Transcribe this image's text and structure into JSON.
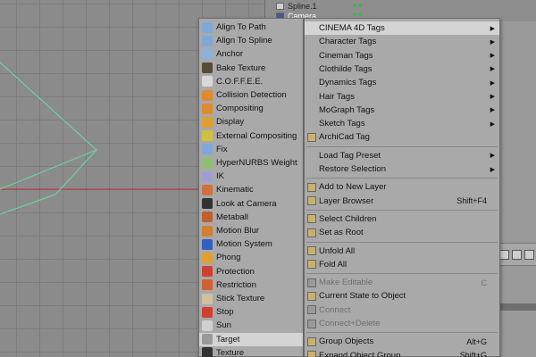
{
  "object_manager": {
    "rows": [
      {
        "label": "Spline.1",
        "selected": false
      },
      {
        "label": "Camera",
        "selected": true
      }
    ]
  },
  "tag_menu": {
    "items": [
      {
        "label": "Align To Path",
        "icon": "align-path-icon",
        "color": "#7fa8d8"
      },
      {
        "label": "Align To Spline",
        "icon": "align-spline-icon",
        "color": "#7fa8d8"
      },
      {
        "label": "Anchor",
        "icon": "anchor-icon",
        "color": "#8cb0d8"
      },
      {
        "label": "Bake Texture",
        "icon": "bake-texture-icon",
        "color": "#5a4a3a"
      },
      {
        "label": "C.O.F.F.E.E.",
        "icon": "coffee-icon",
        "color": "#d8d8d8"
      },
      {
        "label": "Collision Detection",
        "icon": "collision-icon",
        "color": "#e08a30"
      },
      {
        "label": "Compositing",
        "icon": "compositing-icon",
        "color": "#e08a30"
      },
      {
        "label": "Display",
        "icon": "display-icon",
        "color": "#e0a030"
      },
      {
        "label": "External Compositing",
        "icon": "external-compositing-icon",
        "color": "#d0c040"
      },
      {
        "label": "Fix",
        "icon": "fix-icon",
        "color": "#7fa8d8"
      },
      {
        "label": "HyperNURBS Weight",
        "icon": "hypernurbs-weight-icon",
        "color": "#8fc070"
      },
      {
        "label": "IK",
        "icon": "ik-icon",
        "color": "#a0a0d0"
      },
      {
        "label": "Kinematic",
        "icon": "kinematic-icon",
        "color": "#d07040"
      },
      {
        "label": "Look at Camera",
        "icon": "look-at-camera-icon",
        "color": "#333333"
      },
      {
        "label": "Metaball",
        "icon": "metaball-icon",
        "color": "#c06030"
      },
      {
        "label": "Motion Blur",
        "icon": "motion-blur-icon",
        "color": "#d08030"
      },
      {
        "label": "Motion System",
        "icon": "motion-system-icon",
        "color": "#3060c0"
      },
      {
        "label": "Phong",
        "icon": "phong-icon",
        "color": "#e0a030"
      },
      {
        "label": "Protection",
        "icon": "protection-icon",
        "color": "#d04030"
      },
      {
        "label": "Restriction",
        "icon": "restriction-icon",
        "color": "#d06030"
      },
      {
        "label": "Stick Texture",
        "icon": "stick-texture-icon",
        "color": "#d0c0a0"
      },
      {
        "label": "Stop",
        "icon": "stop-icon",
        "color": "#d04030"
      },
      {
        "label": "Sun",
        "icon": "sun-icon",
        "color": "#d0d0d0"
      },
      {
        "label": "Target",
        "icon": "target-icon",
        "color": "#9a9a9a",
        "highlighted": true
      },
      {
        "label": "Texture",
        "icon": "texture-icon",
        "color": "#333333"
      }
    ]
  },
  "context_menu": {
    "items": [
      {
        "label": "CINEMA 4D Tags",
        "arrow": "▶",
        "highlighted": true
      },
      {
        "label": "Character Tags",
        "arrow": "▶"
      },
      {
        "label": "Cineman Tags",
        "arrow": "▶"
      },
      {
        "label": "Clothilde Tags",
        "arrow": "▶"
      },
      {
        "label": "Dynamics Tags",
        "arrow": "▶"
      },
      {
        "label": "Hair Tags",
        "arrow": "▶"
      },
      {
        "label": "MoGraph Tags",
        "arrow": "▶"
      },
      {
        "label": "Sketch Tags",
        "arrow": "▶"
      },
      {
        "label": "ArchiCad Tag",
        "icon": "archicad-icon"
      },
      {
        "sep": true
      },
      {
        "label": "Load Tag Preset",
        "arrow": "▶"
      },
      {
        "label": "Restore Selection",
        "arrow": "▶"
      },
      {
        "sep": true
      },
      {
        "label": "Add to New Layer",
        "icon": "layer-add-icon"
      },
      {
        "label": "Layer Browser",
        "icon": "layer-browser-icon",
        "shortcut": "Shift+F4"
      },
      {
        "sep": true
      },
      {
        "label": "Select Children",
        "icon": "select-children-icon"
      },
      {
        "label": "Set as Root",
        "icon": "set-root-icon"
      },
      {
        "sep": true
      },
      {
        "label": "Unfold All",
        "icon": "unfold-icon"
      },
      {
        "label": "Fold All",
        "icon": "fold-icon"
      },
      {
        "sep": true
      },
      {
        "label": "Make Editable",
        "icon": "make-editable-icon",
        "shortcut": "C",
        "disabled": true
      },
      {
        "label": "Current State to Object",
        "icon": "current-state-icon"
      },
      {
        "label": "Connect",
        "icon": "connect-icon",
        "disabled": true
      },
      {
        "label": "Connect+Delete",
        "icon": "connect-delete-icon",
        "disabled": true
      },
      {
        "sep": true
      },
      {
        "label": "Group Objects",
        "icon": "group-icon",
        "shortcut": "Alt+G"
      },
      {
        "label": "Expand Object Group",
        "icon": "expand-group-icon",
        "shortcut": "Shift+G"
      }
    ]
  }
}
